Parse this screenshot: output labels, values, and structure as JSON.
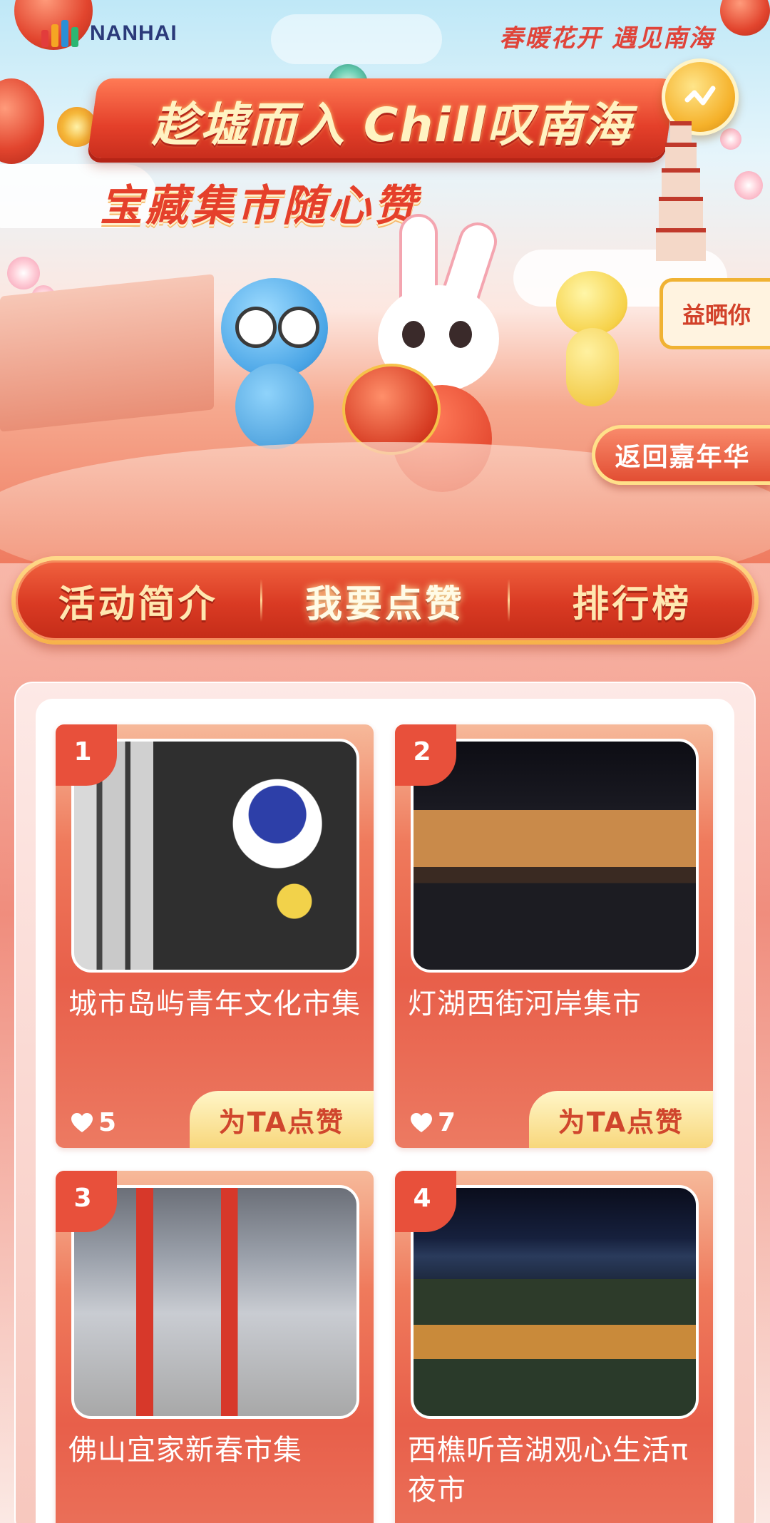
{
  "header": {
    "logo_prefix": "i",
    "logo_text": "NANHAI",
    "slogan": "春暖花开  遇见南海",
    "title_main": "趁墟而入 Chill叹南海",
    "title_sub": "宝藏集市随心赞",
    "stall_sign": "益晒你",
    "back_button": "返回嘉年华"
  },
  "tabs": [
    {
      "label": "活动简介",
      "active": false
    },
    {
      "label": "我要点赞",
      "active": true
    },
    {
      "label": "排行榜",
      "active": false
    }
  ],
  "cards": [
    {
      "rank": "1",
      "title": "城市岛屿青年文化市集",
      "likes": "5",
      "vote_label": "为TA点赞"
    },
    {
      "rank": "2",
      "title": "灯湖西街河岸集市",
      "likes": "7",
      "vote_label": "为TA点赞"
    },
    {
      "rank": "3",
      "title": "佛山宜家新春市集",
      "likes": "",
      "vote_label": ""
    },
    {
      "rank": "4",
      "title": "西樵听音湖观心生活π夜市",
      "likes": "",
      "vote_label": ""
    }
  ],
  "icons": {
    "heart": "heart-icon",
    "badge": "music-note-icon"
  },
  "colors": {
    "accent_red": "#e24e33",
    "gold": "#f7b24a",
    "card_red": "#e85f4a",
    "vote_text": "#d0462d"
  }
}
